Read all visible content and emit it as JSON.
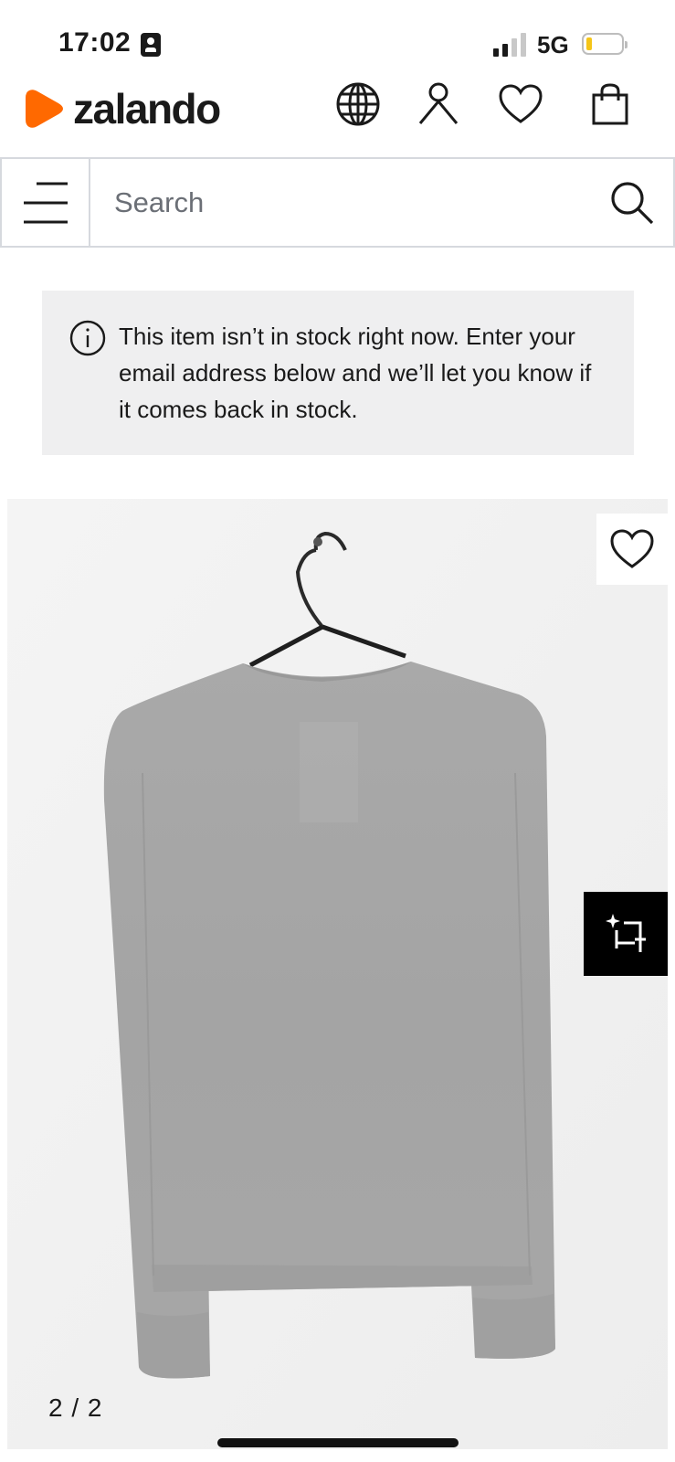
{
  "status_bar": {
    "time": "17:02",
    "network": "5G",
    "battery_level_fraction": 0.12,
    "battery_color": "#f5c518"
  },
  "header": {
    "brand": "zalando",
    "brand_color": "#ff6900",
    "icons": [
      "globe-icon",
      "account-icon",
      "wishlist-icon",
      "bag-icon"
    ]
  },
  "search": {
    "placeholder": "Search",
    "value": ""
  },
  "notice": {
    "icon": "info-icon",
    "text": "This item isn’t in stock right now. Enter your email address below and we’ll let you know if it comes back in stock."
  },
  "gallery": {
    "counter": "2 / 2",
    "wishlist_icon": "heart-icon",
    "ai_button_icon": "sparkle-crop-icon"
  }
}
